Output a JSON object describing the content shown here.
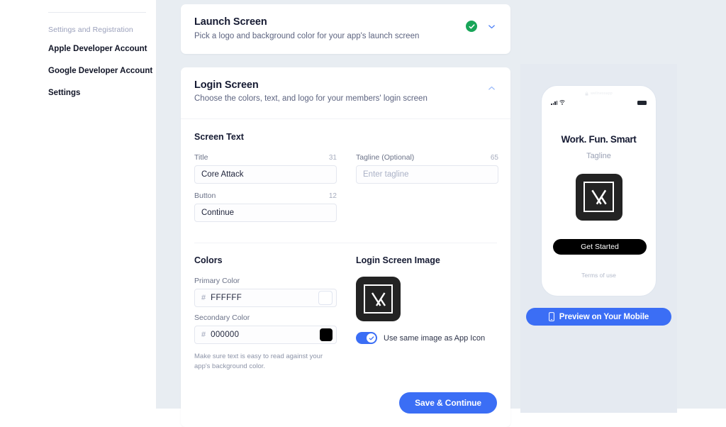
{
  "sidebar": {
    "section_label": "Settings and Registration",
    "items": [
      {
        "label": "Apple Developer Account"
      },
      {
        "label": "Google Developer Account"
      },
      {
        "label": "Settings"
      }
    ]
  },
  "launch_card": {
    "title": "Launch Screen",
    "subtitle": "Pick a logo and background color for your app's launch screen",
    "status_icon": "check-circle-icon",
    "chevron_icon": "chevron-down-icon",
    "status_color": "#18a558"
  },
  "login_card": {
    "title": "Login Screen",
    "subtitle": "Choose the colors, text, and logo for your members' login screen",
    "chevron_icon": "chevron-up-icon",
    "screen_text": {
      "heading": "Screen Text",
      "fields": [
        {
          "label": "Title",
          "count": "31",
          "value": "Core Attack",
          "placeholder": ""
        },
        {
          "label": "Tagline (Optional)",
          "count": "65",
          "value": "",
          "placeholder": "Enter tagline"
        },
        {
          "label": "Button",
          "count": "12",
          "value": "Continue",
          "placeholder": ""
        }
      ]
    },
    "colors": {
      "heading": "Colors",
      "primary": {
        "label": "Primary Color",
        "hash": "#",
        "hex": "FFFFFF",
        "swatch": "#FFFFFF"
      },
      "secondary": {
        "label": "Secondary Color",
        "hash": "#",
        "hex": "000000",
        "swatch": "#000000"
      },
      "helper": "Make sure text is easy to read against your app's background color."
    },
    "login_image": {
      "heading": "Login Screen Image",
      "logo_icon": "app-logo-icon",
      "toggle_label": "Use same image as App Icon",
      "toggle_on": true,
      "toggle_color": "#3b6ef5"
    },
    "save_label": "Save & Continue",
    "accent_color": "#3b6ef5"
  },
  "preview": {
    "phone": {
      "url_text": "wellnessapp",
      "lock_icon": "lock-icon",
      "signal_icon": "signal-bars-icon",
      "wifi_icon": "wifi-icon",
      "battery_icon": "battery-icon",
      "title": "Work. Fun. Smart",
      "tagline": "Tagline",
      "logo_icon": "app-logo-icon",
      "cta_label": "Get Started",
      "terms_label": "Terms of use"
    },
    "mobile_button": {
      "label": "Preview on Your Mobile",
      "icon": "mobile-phone-icon"
    }
  }
}
